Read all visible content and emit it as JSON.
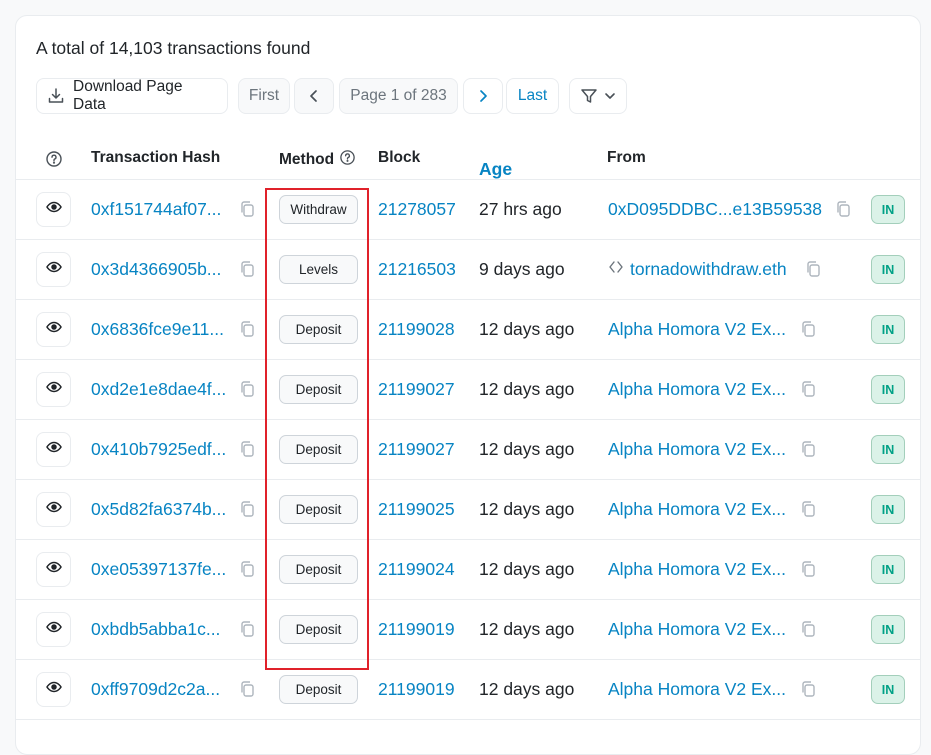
{
  "summary": "A total of 14,103 transactions found",
  "toolbar": {
    "download_label": "Download Page Data",
    "first_label": "First",
    "page_label": "Page 1 of 283",
    "last_label": "Last"
  },
  "columns": {
    "hash": "Transaction Hash",
    "method": "Method",
    "block": "Block",
    "age": "Age",
    "from": "From"
  },
  "rows": [
    {
      "hash": "0xf151744af07...",
      "method": "Withdraw",
      "block": "21278057",
      "age": "27 hrs ago",
      "from": "0xD095DDBC...e13B59538",
      "direction": "IN"
    },
    {
      "hash": "0x3d4366905b...",
      "method": "Levels",
      "block": "21216503",
      "age": "9 days ago",
      "from": "tornadowithdraw.eth",
      "direction": "IN"
    },
    {
      "hash": "0x6836fce9e11...",
      "method": "Deposit",
      "block": "21199028",
      "age": "12 days ago",
      "from": "Alpha Homora V2 Ex...",
      "direction": "IN"
    },
    {
      "hash": "0xd2e1e8dae4f...",
      "method": "Deposit",
      "block": "21199027",
      "age": "12 days ago",
      "from": "Alpha Homora V2 Ex...",
      "direction": "IN"
    },
    {
      "hash": "0x410b7925edf...",
      "method": "Deposit",
      "block": "21199027",
      "age": "12 days ago",
      "from": "Alpha Homora V2 Ex...",
      "direction": "IN"
    },
    {
      "hash": "0x5d82fa6374b...",
      "method": "Deposit",
      "block": "21199025",
      "age": "12 days ago",
      "from": "Alpha Homora V2 Ex...",
      "direction": "IN"
    },
    {
      "hash": "0xe05397137fe...",
      "method": "Deposit",
      "block": "21199024",
      "age": "12 days ago",
      "from": "Alpha Homora V2 Ex...",
      "direction": "IN"
    },
    {
      "hash": "0xbdb5abba1c...",
      "method": "Deposit",
      "block": "21199019",
      "age": "12 days ago",
      "from": "Alpha Homora V2 Ex...",
      "direction": "IN"
    },
    {
      "hash": "0xff9709d2c2a...",
      "method": "Deposit",
      "block": "21199019",
      "age": "12 days ago",
      "from": "Alpha Homora V2 Ex...",
      "direction": "IN"
    }
  ],
  "icons": {
    "download": "download-icon",
    "prev": "chevron-left-icon",
    "next": "chevron-right-icon",
    "filter": "filter-icon",
    "help": "question-circle-icon",
    "eye": "eye-icon",
    "copy": "copy-icon",
    "contract": "code-icon"
  },
  "colors": {
    "link": "#0784c3",
    "badge_in_bg": "#dbf2e8",
    "badge_in_text": "#00a186",
    "highlight": "#e0212a"
  }
}
